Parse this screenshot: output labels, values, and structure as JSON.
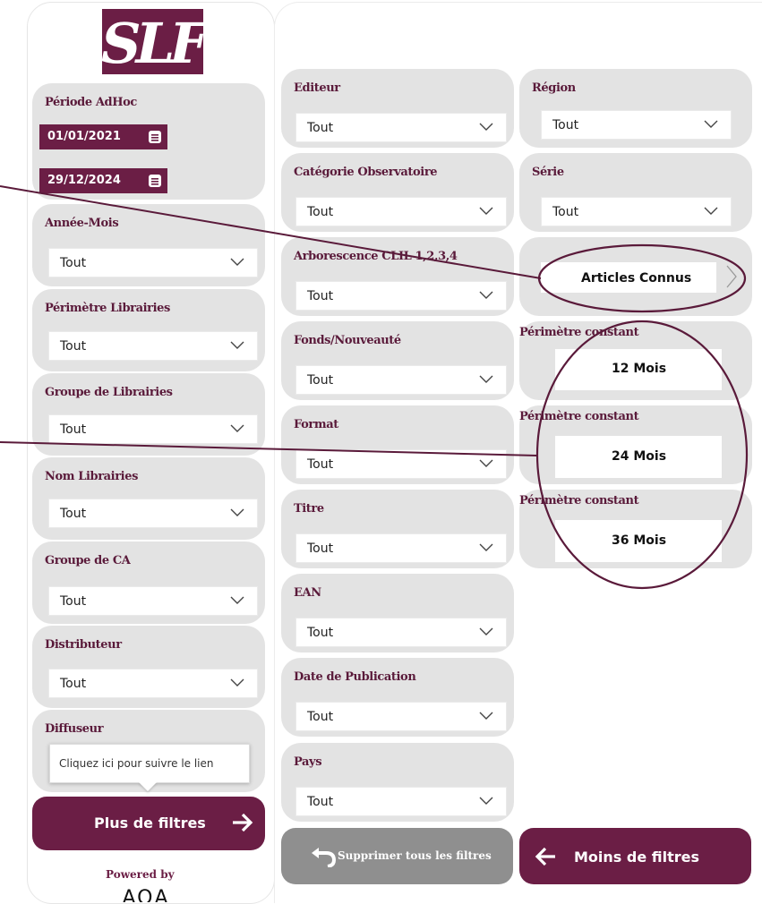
{
  "logo": {
    "text": "SLF",
    "color": "#6b1e45"
  },
  "accent_color": "#6b1e45",
  "period": {
    "label": "Période AdHoc",
    "start": "01/01/2021",
    "end": "29/12/2024"
  },
  "left_filters": [
    {
      "label": "Année-Mois",
      "value": "Tout"
    },
    {
      "label": "Périmètre Librairies",
      "value": "Tout"
    },
    {
      "label": "Groupe de Librairies",
      "value": "Tout"
    },
    {
      "label": "Nom Librairies",
      "value": "Tout"
    },
    {
      "label": "Groupe de CA",
      "value": "Tout"
    },
    {
      "label": "Distributeur",
      "value": "Tout"
    },
    {
      "label": "Diffuseur",
      "value": ""
    }
  ],
  "tooltip": {
    "text": "Cliquez ici pour suivre le lien"
  },
  "more_filters_button": {
    "label": "Plus de filtres",
    "icon": "arrow-right-icon"
  },
  "powered": {
    "text": "Powered by",
    "brand": "AQA"
  },
  "middle_filters": [
    {
      "label": "Editeur",
      "value": "Tout"
    },
    {
      "label": "Catégorie Observatoire",
      "value": "Tout"
    },
    {
      "label": "Arborescence CLIL 1,2,3,4",
      "value": "Tout"
    },
    {
      "label": "Fonds/Nouveauté",
      "value": "Tout"
    },
    {
      "label": "Format",
      "value": "Tout"
    },
    {
      "label": "Titre",
      "value": "Tout"
    },
    {
      "label": "EAN",
      "value": "Tout"
    },
    {
      "label": "Date de Publication",
      "value": "Tout"
    },
    {
      "label": "Pays",
      "value": "Tout"
    }
  ],
  "right_filters": [
    {
      "label": "Région",
      "value": "Tout"
    },
    {
      "label": "Série",
      "value": "Tout"
    }
  ],
  "articles_connus": {
    "label": "Articles Connus"
  },
  "perimetres": [
    {
      "label": "Périmètre constant",
      "value": "12 Mois"
    },
    {
      "label": "Périmètre constant",
      "value": "24 Mois"
    },
    {
      "label": "Périmètre constant",
      "value": "36 Mois"
    }
  ],
  "clear_button": {
    "label": "Supprimer tous les filtres",
    "icon": "undo-arrow-icon"
  },
  "less_filters_button": {
    "label": "Moins de filtres",
    "icon": "arrow-left-icon"
  }
}
